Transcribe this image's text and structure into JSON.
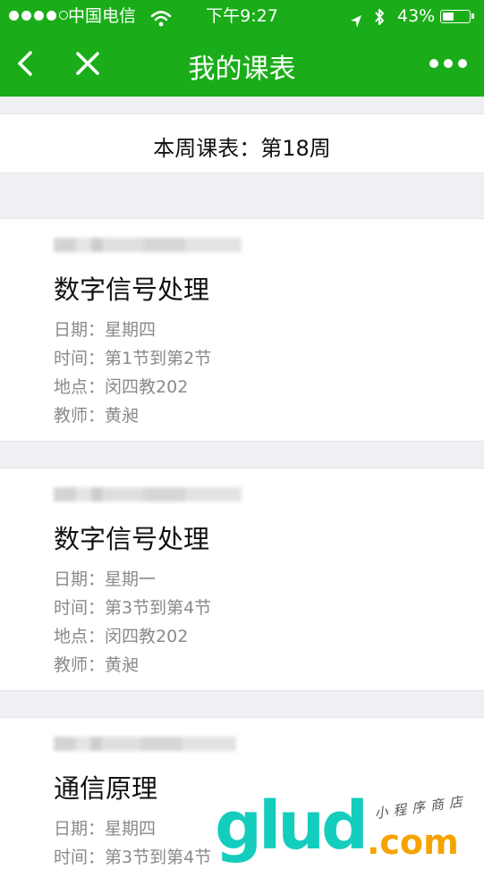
{
  "status_bar": {
    "carrier": "中国电信",
    "time": "下午9:27",
    "battery_percent": "43%",
    "battery_level": 0.43,
    "signal_bars": 4,
    "icons": [
      "wifi-icon",
      "location-arrow-icon",
      "bluetooth-icon",
      "battery-icon"
    ]
  },
  "nav": {
    "title": "我的课表",
    "back_icon": "chevron-left-icon",
    "close_icon": "close-icon",
    "more_icon": "more-dots-icon"
  },
  "week": {
    "label": "本周课表：第18周"
  },
  "courses": [
    {
      "name": "数字信号处理",
      "date_label": "日期：",
      "date": "星期四",
      "time_label": "时间：",
      "time": "第1节到第2节",
      "place_label": "地点：",
      "place": "闵四教202",
      "teacher_label": "教师：",
      "teacher": "黄昶"
    },
    {
      "name": "数字信号处理",
      "date_label": "日期：",
      "date": "星期一",
      "time_label": "时间：",
      "time": "第3节到第4节",
      "place_label": "地点：",
      "place": "闵四教202",
      "teacher_label": "教师：",
      "teacher": "黄昶"
    },
    {
      "name": "通信原理",
      "date_label": "日期：",
      "date": "星期四",
      "time_label": "时间：",
      "time": "第3节到第4节"
    }
  ],
  "watermark": {
    "main": "glud",
    "suffix": ".com",
    "tagline": "小程序商店"
  },
  "colors": {
    "nav_green": "#1aad19",
    "page_bg": "#efeff4",
    "secondary_text": "#8a8a8a"
  }
}
